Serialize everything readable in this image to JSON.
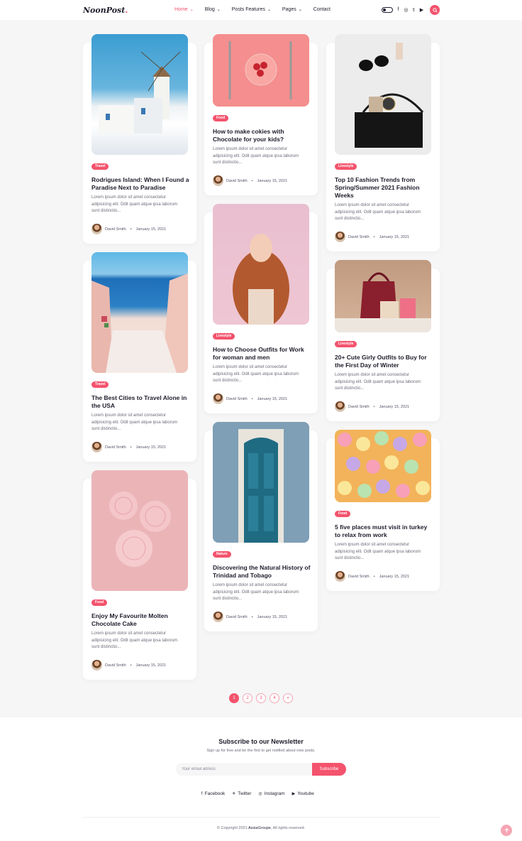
{
  "header": {
    "logo": {
      "main": "NoonPost",
      "dot": "."
    },
    "nav": [
      {
        "label": "Home",
        "has_dropdown": true
      },
      {
        "label": "Blog",
        "has_dropdown": true
      },
      {
        "label": "Posts Features",
        "has_dropdown": true
      },
      {
        "label": "Pages",
        "has_dropdown": true
      },
      {
        "label": "Contact",
        "has_dropdown": false
      }
    ],
    "social_icons": [
      "facebook-icon",
      "instagram-icon",
      "twitter-icon",
      "youtube-icon"
    ],
    "accent_color": "#f3536d"
  },
  "posts": [
    {
      "category": "Travel",
      "title": "Rodrigues Island: When I Found a Paradise Next to Paradise",
      "excerpt": "Lorem ipsum dolor sit amet consectetur adipisicing elit. Odit quam atque ipsa laborum sunt distinctio...",
      "author": "David Smith",
      "date": "January 15, 2021"
    },
    {
      "category": "Food",
      "title": "How to make cokies with Chocolate for your kids?",
      "excerpt": "Lorem ipsum dolor sit amet consectetur adipisicing elit. Odit quam atque ipsa laborum sunt distinctio...",
      "author": "David Smith",
      "date": "January 15, 2021"
    },
    {
      "category": "Livestyle",
      "title": "Top 10 Fashion Trends from Spring/Summer 2021 Fashion Weeks",
      "excerpt": "Lorem ipsum dolor sit amet consectetur adipisicing elit. Odit quam atque ipsa laborum sunt distinctio...",
      "author": "David Smith",
      "date": "January 15, 2021"
    },
    {
      "category": "Travel",
      "title": "The Best Cities to Travel Alone in the USA",
      "excerpt": "Lorem ipsum dolor sit amet consectetur adipisicing elit. Odit quam atque ipsa laborum sunt distinctio...",
      "author": "David Smith",
      "date": "January 15, 2021"
    },
    {
      "category": "Livestyle",
      "title": "How to Choose Outfits for Work for woman and men",
      "excerpt": "Lorem ipsum dolor sit amet consectetur adipisicing elit. Odit quam atque ipsa laborum sunt distinctio...",
      "author": "David Smith",
      "date": "January 15, 2021"
    },
    {
      "category": "Livestyle",
      "title": "20+ Cute Girly Outfits to Buy for the First Day of Winter",
      "excerpt": "Lorem ipsum dolor sit amet consectetur adipisicing elit. Odit quam atque ipsa laborum sunt distinctio...",
      "author": "David Smith",
      "date": "January 15, 2021"
    },
    {
      "category": "Food",
      "title": "Enjoy My Favourite Molten Chocolate Cake",
      "excerpt": "Lorem ipsum dolor sit amet consectetur adipisicing elit. Odit quam atque ipsa laborum sunt distinctio...",
      "author": "David Smith",
      "date": "January 15, 2021"
    },
    {
      "category": "Nature",
      "title": "Discovering the Natural History of Trinidad and Tobago",
      "excerpt": "Lorem ipsum dolor sit amet consectetur adipisicing elit. Odit quam atque ipsa laborum sunt distinctio...",
      "author": "David Smith",
      "date": "January 15, 2021"
    },
    {
      "category": "Food",
      "title": "5 five places must visit in turkey to relax from work",
      "excerpt": "Lorem ipsum dolor sit amet consectetur adipisicing elit. Odit quam atque ipsa laborum sunt distinctio...",
      "author": "David Smith",
      "date": "January 15, 2021"
    }
  ],
  "pagination": {
    "pages": [
      "1",
      "2",
      "3",
      "4"
    ],
    "next": "»",
    "current": "1"
  },
  "newsletter": {
    "title": "Subscribe to our Newsletter",
    "subtitle": "Sign up for free and be the first to get notified about new posts.",
    "email_placeholder": "Your email adress",
    "button": "Subscribe"
  },
  "footer": {
    "socials": [
      {
        "label": "Facebook",
        "icon": "facebook-icon"
      },
      {
        "label": "Twitter",
        "icon": "twitter-icon"
      },
      {
        "label": "Instagram",
        "icon": "instagram-icon"
      },
      {
        "label": "Youtube",
        "icon": "youtube-icon"
      }
    ],
    "copyright_prefix": "© Copyright 2021",
    "copyright_brand": "AssiaGroupe",
    "copyright_suffix": ", All rights reserved."
  }
}
